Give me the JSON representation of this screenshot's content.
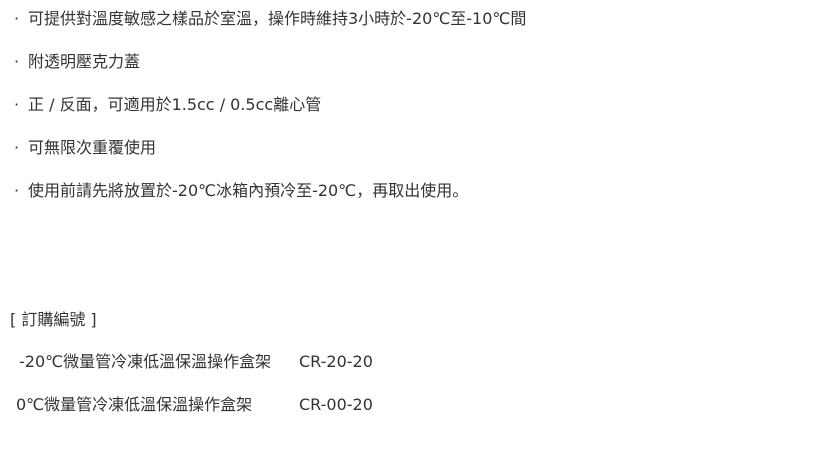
{
  "features": {
    "bullet": "·",
    "items": [
      "可提供對溫度敏感之樣品於室溫，操作時維持3小時於-20℃至-10℃間",
      "附透明壓克力蓋",
      "正 / 反面，可適用於1.5cc / 0.5cc離心管",
      "可無限次重覆使用",
      "使用前請先將放置於-20℃冰箱內預冷至-20℃，再取出使用。"
    ]
  },
  "order": {
    "heading": "[ 訂購編號 ]",
    "rows": [
      {
        "name": "-20℃微量管冷凍低溫保溫操作盒架",
        "code": "CR-20-20"
      },
      {
        "name": "0℃微量管冷凍低溫保溫操作盒架",
        "code": "CR-00-20"
      }
    ]
  }
}
